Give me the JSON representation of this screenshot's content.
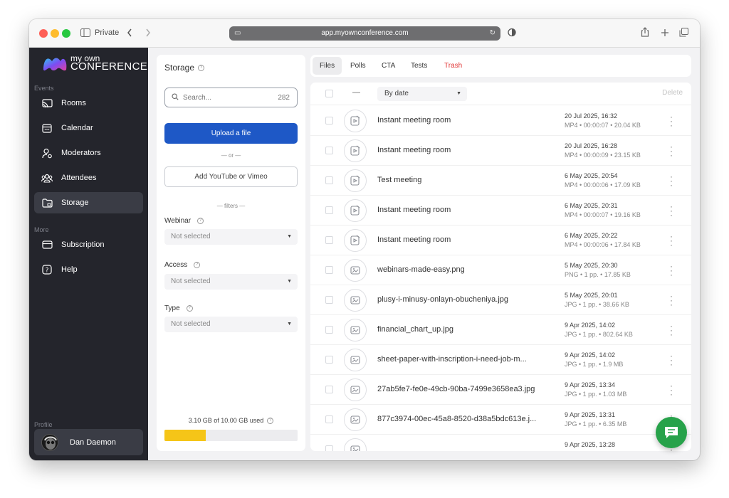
{
  "browser": {
    "private_label": "Private",
    "url": "app.myownconference.com"
  },
  "sidebar": {
    "logo": {
      "line1": "my own",
      "line2": "CONFERENCE"
    },
    "section_events": "Events",
    "section_more": "More",
    "section_profile": "Profile",
    "items": [
      {
        "label": "Rooms",
        "icon": "cast-icon"
      },
      {
        "label": "Calendar",
        "icon": "calendar-icon"
      },
      {
        "label": "Moderators",
        "icon": "user-gear-icon"
      },
      {
        "label": "Attendees",
        "icon": "users-icon"
      },
      {
        "label": "Storage",
        "icon": "folder-icon",
        "active": true
      },
      {
        "label": "Subscription",
        "icon": "card-icon"
      },
      {
        "label": "Help",
        "icon": "help-icon"
      }
    ],
    "profile_name": "Dan Daemon"
  },
  "storage": {
    "title": "Storage",
    "search_placeholder": "Search...",
    "search_count": "282",
    "upload_label": "Upload a file",
    "or_label": "— or —",
    "add_video_label": "Add YouTube or Vimeo",
    "filters_label": "— filters —",
    "webinar_label": "Webinar",
    "webinar_value": "Not selected",
    "access_label": "Access",
    "access_value": "Not selected",
    "type_label": "Type",
    "type_value": "Not selected",
    "usage_text": "3.10 GB of 10.00 GB used",
    "usage_fraction": 0.31
  },
  "tabs": [
    {
      "label": "Files",
      "active": true
    },
    {
      "label": "Polls"
    },
    {
      "label": "CTA"
    },
    {
      "label": "Tests"
    },
    {
      "label": "Trash"
    }
  ],
  "list": {
    "select_all_dash": "—",
    "sort_value": "By date",
    "delete_label": "Delete",
    "files": [
      {
        "name": "Instant meeting room",
        "date": "20 Jul 2025, 16:32",
        "meta": "MP4 • 00:00:07 • 20.04 KB",
        "kind": "video"
      },
      {
        "name": "Instant meeting room",
        "date": "20 Jul 2025, 16:28",
        "meta": "MP4 • 00:00:09 • 23.15 KB",
        "kind": "video"
      },
      {
        "name": "Test meeting",
        "date": "6 May 2025, 20:54",
        "meta": "MP4 • 00:00:06 • 17.09 KB",
        "kind": "video"
      },
      {
        "name": "Instant meeting room",
        "date": "6 May 2025, 20:31",
        "meta": "MP4 • 00:00:07 • 19.16 KB",
        "kind": "video"
      },
      {
        "name": "Instant meeting room",
        "date": "6 May 2025, 20:22",
        "meta": "MP4 • 00:00:06 • 17.84 KB",
        "kind": "video"
      },
      {
        "name": "webinars-made-easy.png",
        "date": "5 May 2025, 20:30",
        "meta": "PNG • 1 pp. • 17.85 KB",
        "kind": "image"
      },
      {
        "name": "plusy-i-minusy-onlayn-obucheniya.jpg",
        "date": "5 May 2025, 20:01",
        "meta": "JPG • 1 pp. • 38.66 KB",
        "kind": "image"
      },
      {
        "name": "financial_chart_up.jpg",
        "date": "9 Apr 2025, 14:02",
        "meta": "JPG • 1 pp. • 802.64 KB",
        "kind": "image"
      },
      {
        "name": "sheet-paper-with-inscription-i-need-job-m...",
        "date": "9 Apr 2025, 14:02",
        "meta": "JPG • 1 pp. • 1.9 MB",
        "kind": "image"
      },
      {
        "name": "27ab5fe7-fe0e-49cb-90ba-7499e3658ea3.jpg",
        "date": "9 Apr 2025, 13:34",
        "meta": "JPG • 1 pp. • 1.03 MB",
        "kind": "image"
      },
      {
        "name": "877c3974-00ec-45a8-8520-d38a5bdc613e.j...",
        "date": "9 Apr 2025, 13:31",
        "meta": "JPG • 1 pp. • 6.35 MB",
        "kind": "image"
      },
      {
        "name": "",
        "date": "9 Apr 2025, 13:28",
        "meta": "",
        "kind": "image"
      }
    ]
  },
  "colors": {
    "sidebar_bg": "#24252c",
    "primary": "#1e58c6",
    "trash": "#e23b3b",
    "usage_fill": "#f5c518",
    "chat": "#27a24a"
  }
}
